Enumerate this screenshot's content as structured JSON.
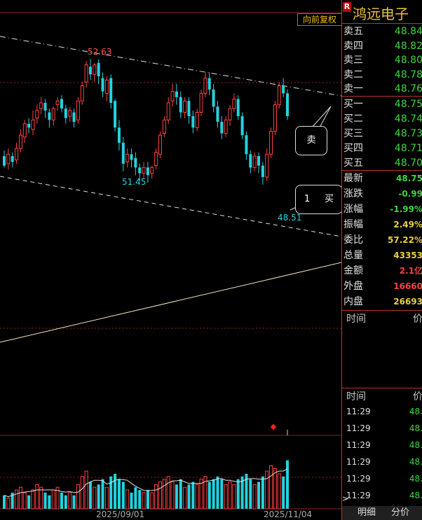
{
  "stock": {
    "badge": "R",
    "name": "鸿远电子"
  },
  "toolbar": {
    "restore_label": "向前复权"
  },
  "order_book": [
    {
      "label": "卖五",
      "price": "48.84"
    },
    {
      "label": "卖四",
      "price": "48.82"
    },
    {
      "label": "卖三",
      "price": "48.80"
    },
    {
      "label": "卖二",
      "price": "48.78"
    },
    {
      "label": "卖一",
      "price": "48.76"
    },
    {
      "label": "买一",
      "price": "48.75"
    },
    {
      "label": "买二",
      "price": "48.74"
    },
    {
      "label": "买三",
      "price": "48.73"
    },
    {
      "label": "买四",
      "price": "48.71"
    },
    {
      "label": "买五",
      "price": "48.70"
    }
  ],
  "stats": [
    {
      "label": "最新",
      "value": "48.75",
      "color": "#3fd63f"
    },
    {
      "label": "涨跌",
      "value": "-0.99",
      "color": "#3fd63f"
    },
    {
      "label": "涨幅",
      "value": "-1.99%",
      "color": "#3fd63f"
    },
    {
      "label": "振幅",
      "value": "2.49%",
      "color": "#e8d040"
    },
    {
      "label": "委比",
      "value": "57.22%",
      "color": "#e8d040"
    },
    {
      "label": "总量",
      "value": "43353",
      "color": "#e8d040"
    },
    {
      "label": "金额",
      "value": "2.1亿",
      "color": "#ff4040"
    },
    {
      "label": "外盘",
      "value": "16660",
      "color": "#ff4040"
    },
    {
      "label": "内盘",
      "value": "26693",
      "color": "#e8d040"
    }
  ],
  "section1": {
    "time_label": "时间",
    "price_label": "价"
  },
  "section2": {
    "time_label": "时间",
    "price_label": "价"
  },
  "ticks": [
    {
      "time": "11:29",
      "price": "48."
    },
    {
      "time": "11:29",
      "price": "48."
    },
    {
      "time": "11:29",
      "price": "48."
    },
    {
      "time": "11:29",
      "price": "48."
    },
    {
      "time": "11:29",
      "price": "48."
    },
    {
      "time": "11:29",
      "price": "48."
    }
  ],
  "tabs": {
    "detail": "明细",
    "price": "分价"
  },
  "annotations": {
    "sell": "卖",
    "buy": "买",
    "buy_count": "1"
  },
  "chart_data": {
    "type": "candlestick",
    "high_label": "52.63",
    "low_label_1": "51.45",
    "low_label_2": "48.51",
    "x_dates": [
      "2025/09/01",
      "2025/11/04"
    ],
    "colors": {
      "up": "#ff4040",
      "down": "#22d3e0"
    },
    "candles": [
      [
        49.5,
        49.0,
        49.8,
        48.9
      ],
      [
        49.1,
        49.6,
        49.9,
        48.8
      ],
      [
        49.5,
        49.2,
        49.7,
        48.9
      ],
      [
        49.3,
        49.9,
        50.2,
        49.1
      ],
      [
        49.9,
        50.6,
        50.9,
        49.7
      ],
      [
        50.5,
        51.2,
        51.4,
        50.2
      ],
      [
        51.2,
        51.0,
        51.5,
        50.7
      ],
      [
        50.9,
        51.4,
        51.9,
        50.6
      ],
      [
        51.5,
        51.9,
        52.2,
        51.2
      ],
      [
        52.0,
        52.3,
        52.6,
        51.7
      ],
      [
        52.3,
        51.9,
        52.5,
        51.5
      ],
      [
        51.8,
        51.4,
        52.0,
        51.0
      ],
      [
        51.4,
        52.0,
        52.1,
        51.1
      ],
      [
        52.2,
        52.4,
        52.6,
        51.9
      ],
      [
        52.5,
        52.0,
        52.7,
        51.8
      ],
      [
        52.0,
        51.5,
        52.2,
        51.2
      ],
      [
        51.6,
        51.9,
        52.1,
        51.3
      ],
      [
        51.8,
        51.3,
        52.0,
        51.0
      ],
      [
        51.4,
        52.4,
        52.6,
        51.2
      ],
      [
        52.4,
        53.2,
        53.4,
        52.2
      ],
      [
        53.4,
        54.3,
        54.5,
        53.1
      ],
      [
        54.2,
        53.8,
        54.6,
        53.5
      ],
      [
        53.8,
        54.3,
        54.4,
        53.4
      ],
      [
        54.4,
        53.7,
        54.6,
        53.3
      ],
      [
        53.6,
        52.9,
        53.9,
        52.6
      ],
      [
        52.8,
        53.5,
        53.7,
        52.4
      ],
      [
        53.6,
        52.3,
        53.8,
        52.0
      ],
      [
        52.4,
        51.0,
        52.5,
        50.8
      ],
      [
        51.0,
        50.2,
        51.4,
        49.8
      ],
      [
        50.2,
        49.1,
        50.5,
        48.7
      ],
      [
        49.2,
        49.6,
        49.9,
        48.9
      ],
      [
        49.6,
        49.3,
        49.9,
        48.9
      ],
      [
        49.4,
        48.9,
        49.7,
        48.5
      ],
      [
        48.9,
        48.6,
        49.1,
        48.2
      ],
      [
        48.6,
        48.9,
        49.2,
        48.3
      ],
      [
        48.9,
        48.5,
        49.2,
        48.1
      ],
      [
        48.6,
        48.9,
        49.0,
        48.3
      ],
      [
        49.0,
        49.7,
        49.9,
        48.8
      ],
      [
        49.6,
        50.6,
        50.8,
        49.4
      ],
      [
        50.7,
        51.4,
        51.6,
        50.5
      ],
      [
        51.4,
        52.3,
        52.6,
        51.2
      ],
      [
        52.4,
        52.9,
        53.3,
        52.1
      ],
      [
        52.9,
        52.6,
        53.3,
        52.2
      ],
      [
        52.6,
        51.8,
        52.9,
        51.5
      ],
      [
        51.8,
        52.4,
        52.6,
        51.5
      ],
      [
        52.4,
        51.6,
        52.6,
        51.2
      ],
      [
        51.6,
        51.0,
        51.9,
        50.7
      ],
      [
        51.0,
        51.8,
        52.0,
        50.8
      ],
      [
        51.8,
        52.8,
        53.0,
        51.6
      ],
      [
        52.8,
        53.6,
        53.9,
        52.6
      ],
      [
        53.6,
        53.0,
        53.9,
        52.7
      ],
      [
        53.0,
        52.1,
        53.3,
        51.8
      ],
      [
        52.1,
        51.3,
        52.4,
        51.0
      ],
      [
        51.3,
        50.7,
        51.6,
        50.4
      ],
      [
        50.7,
        51.4,
        51.6,
        50.5
      ],
      [
        51.4,
        52.0,
        52.2,
        51.1
      ],
      [
        52.0,
        52.5,
        52.8,
        51.8
      ],
      [
        52.5,
        51.6,
        52.7,
        51.4
      ],
      [
        51.6,
        50.6,
        51.8,
        50.4
      ],
      [
        50.6,
        49.6,
        50.8,
        49.3
      ],
      [
        49.6,
        48.9,
        49.8,
        48.6
      ],
      [
        48.9,
        49.5,
        49.7,
        48.7
      ],
      [
        49.5,
        49.0,
        49.7,
        48.6
      ],
      [
        49.0,
        48.4,
        49.2,
        48.0
      ],
      [
        48.4,
        49.6,
        49.9,
        48.2
      ],
      [
        49.6,
        50.8,
        51.0,
        49.4
      ],
      [
        50.8,
        52.2,
        52.4,
        50.6
      ],
      [
        52.2,
        53.2,
        53.4,
        52.0
      ],
      [
        53.2,
        52.8,
        53.6,
        52.6
      ],
      [
        52.8,
        51.6,
        53.0,
        51.4
      ]
    ],
    "volume": [
      5,
      4,
      6,
      7,
      8,
      6,
      5,
      7,
      9,
      8,
      6,
      5,
      7,
      8,
      6,
      5,
      6,
      5,
      9,
      12,
      14,
      10,
      8,
      9,
      11,
      8,
      12,
      13,
      11,
      10,
      7,
      6,
      8,
      7,
      6,
      7,
      6,
      9,
      10,
      11,
      12,
      10,
      9,
      11,
      8,
      9,
      10,
      9,
      11,
      12,
      10,
      11,
      12,
      11,
      9,
      10,
      9,
      11,
      12,
      13,
      11,
      9,
      10,
      12,
      14,
      16,
      15,
      13,
      12,
      18
    ]
  }
}
